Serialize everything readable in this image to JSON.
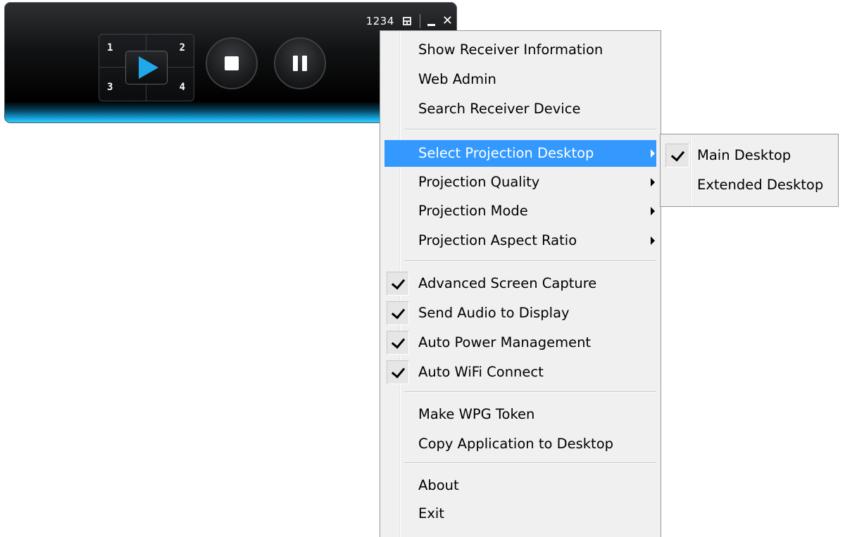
{
  "player": {
    "code": "1234",
    "quadrants": [
      "1",
      "2",
      "3",
      "4"
    ]
  },
  "menu": {
    "items": [
      {
        "label": "Show Receiver Information"
      },
      {
        "label": "Web Admin"
      },
      {
        "label": "Search Receiver Device"
      },
      {
        "label": "Select Projection Desktop",
        "submenu": true,
        "highlighted": true
      },
      {
        "label": "Projection Quality",
        "submenu": true
      },
      {
        "label": "Projection Mode",
        "submenu": true
      },
      {
        "label": "Projection Aspect Ratio",
        "submenu": true
      },
      {
        "label": "Advanced Screen Capture",
        "checked": true
      },
      {
        "label": "Send Audio to Display",
        "checked": true
      },
      {
        "label": "Auto Power Management",
        "checked": true
      },
      {
        "label": "Auto WiFi Connect",
        "checked": true
      },
      {
        "label": "Make WPG Token"
      },
      {
        "label": "Copy Application to Desktop"
      },
      {
        "label": "About"
      },
      {
        "label": "Exit"
      }
    ]
  },
  "submenu": {
    "items": [
      {
        "label": "Main Desktop",
        "checked": true
      },
      {
        "label": "Extended Desktop",
        "checked": false
      }
    ]
  },
  "colors": {
    "highlight": "#3399ff",
    "accent": "#1fa9ea",
    "menu_bg": "#f0f0f0"
  }
}
